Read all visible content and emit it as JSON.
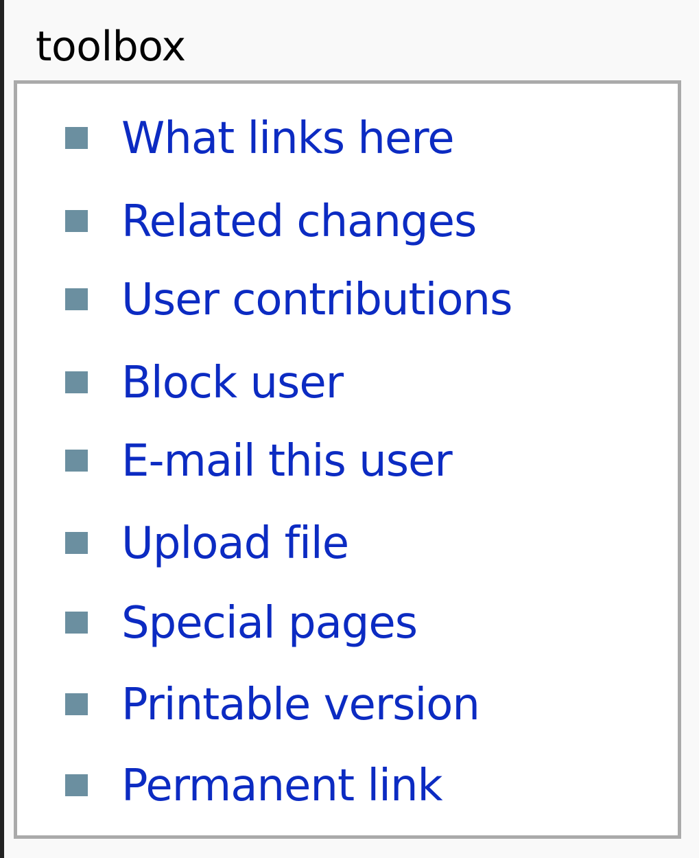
{
  "toolbox": {
    "title": "toolbox",
    "items": [
      {
        "label": "What links here"
      },
      {
        "label": "Related changes"
      },
      {
        "label": "User contributions"
      },
      {
        "label": "Block user"
      },
      {
        "label": "E-mail this user"
      },
      {
        "label": "Upload file"
      },
      {
        "label": "Special pages"
      },
      {
        "label": "Printable version"
      },
      {
        "label": "Permanent link"
      }
    ]
  },
  "colors": {
    "link": "#0c2bc2",
    "bullet": "#6b8fa0",
    "border": "#aaaaaa",
    "background": "#f9f9f9"
  },
  "icons": {
    "bullet": "square-bullet-icon"
  }
}
